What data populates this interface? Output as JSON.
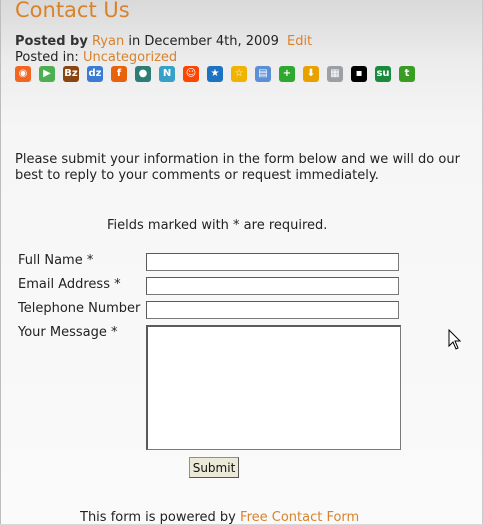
{
  "page": {
    "title": "Contact Us",
    "posted_by_label": "Posted by",
    "author": "Ryan",
    "date_text": "in December 4th, 2009",
    "edit_label": "Edit",
    "posted_in_label": "Posted in:",
    "category": "Uncategorized"
  },
  "share_icons": [
    {
      "name": "share-icon-1",
      "glyph": "◉",
      "color": "#f26522"
    },
    {
      "name": "share-icon-2",
      "glyph": "▶",
      "color": "#4caf50"
    },
    {
      "name": "share-icon-3",
      "glyph": "Bz",
      "color": "#8b4513"
    },
    {
      "name": "share-icon-4",
      "glyph": "dz",
      "color": "#3a7bd5"
    },
    {
      "name": "share-icon-5",
      "glyph": "f",
      "color": "#e8620c"
    },
    {
      "name": "share-icon-6",
      "glyph": "●",
      "color": "#2c7d74"
    },
    {
      "name": "share-icon-7",
      "glyph": "N",
      "color": "#37a0c9"
    },
    {
      "name": "share-icon-8",
      "glyph": "☺",
      "color": "#ff4500"
    },
    {
      "name": "share-icon-9",
      "glyph": "★",
      "color": "#1d72c2"
    },
    {
      "name": "share-icon-10",
      "glyph": "☆",
      "color": "#f0b400"
    },
    {
      "name": "share-icon-11",
      "glyph": "▤",
      "color": "#5b8fd6"
    },
    {
      "name": "share-icon-12",
      "glyph": "+",
      "color": "#2ea82e"
    },
    {
      "name": "share-icon-13",
      "glyph": "⬇",
      "color": "#e8a200"
    },
    {
      "name": "share-icon-14",
      "glyph": "▦",
      "color": "#9aa0a6"
    },
    {
      "name": "share-icon-15",
      "glyph": "▪",
      "color": "#000000"
    },
    {
      "name": "share-icon-16",
      "glyph": "su",
      "color": "#1a8a3c"
    },
    {
      "name": "share-icon-17",
      "glyph": "t",
      "color": "#3a9d23"
    }
  ],
  "content": {
    "intro": "Please submit your information in the form below and we will do our best to reply to your comments or request immediately.",
    "required_note": "Fields marked with * are required."
  },
  "form": {
    "full_name_label": "Full Name *",
    "email_label": "Email Address *",
    "phone_label": "Telephone Number",
    "message_label": "Your Message *",
    "full_name_value": "",
    "email_value": "",
    "phone_value": "",
    "message_value": "",
    "submit_label": "Submit"
  },
  "footer": {
    "powered_text": "This form is powered by",
    "powered_link": "Free Contact Form"
  },
  "colors": {
    "accent": "#d9822b"
  }
}
